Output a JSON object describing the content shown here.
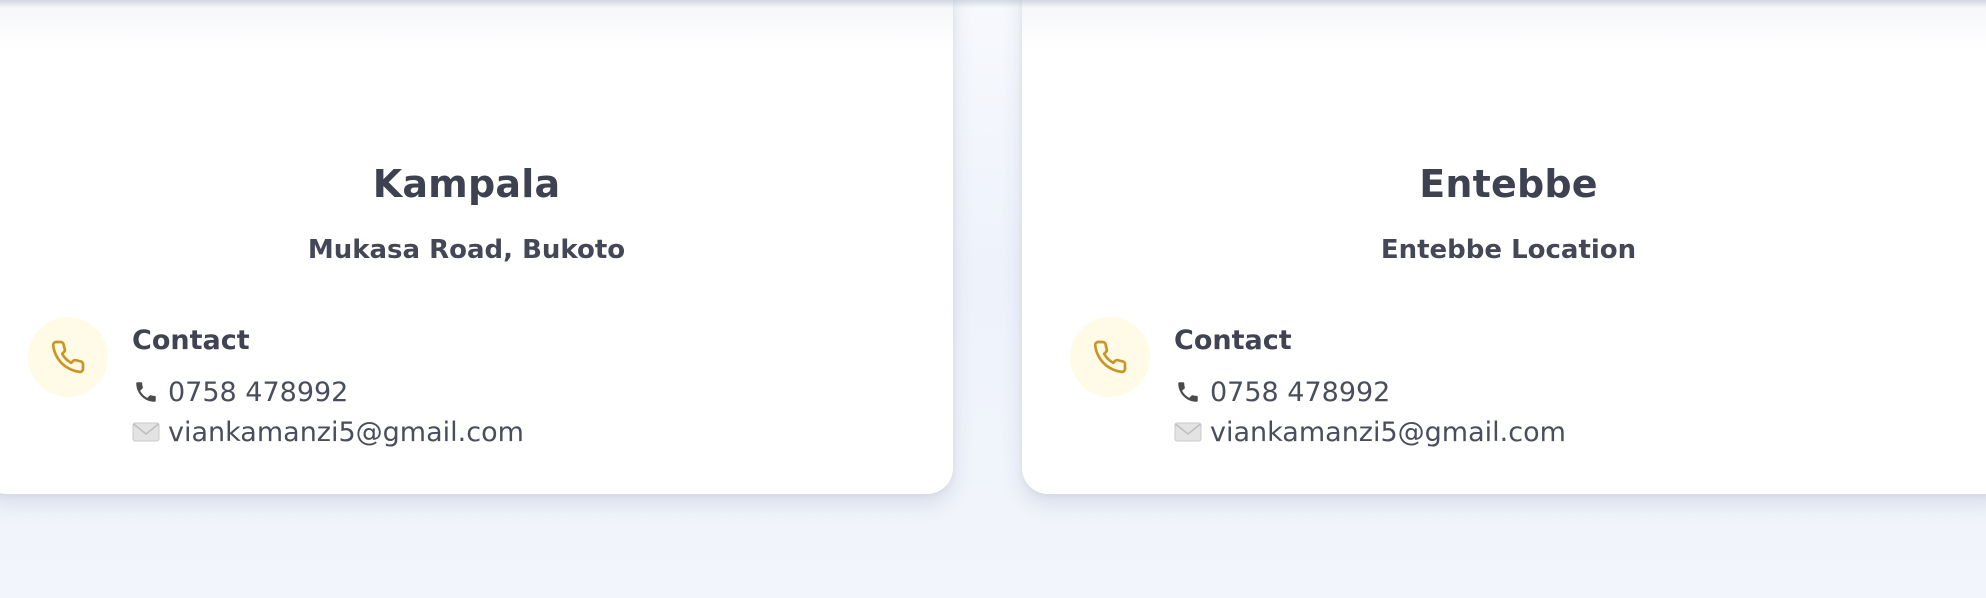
{
  "locations": [
    {
      "city": "Kampala",
      "address": "Mukasa Road, Bukoto",
      "contact_heading": "Contact",
      "phone": "0758 478992",
      "email": "viankamanzi5@gmail.com",
      "icons": {
        "badge": "phone-icon",
        "phone_line": "telephone-receiver-icon",
        "email_line": "envelope-icon"
      }
    },
    {
      "city": "Entebbe",
      "address": "Entebbe Location",
      "contact_heading": "Contact",
      "phone": "0758 478992",
      "email": "viankamanzi5@gmail.com",
      "icons": {
        "badge": "phone-icon",
        "phone_line": "telephone-receiver-icon",
        "email_line": "envelope-icon"
      }
    }
  ],
  "colors": {
    "page_background": "#eef2fb",
    "card_background": "#ffffff",
    "badge_background": "#fffbe6",
    "badge_icon": "#c99527",
    "heading_text": "#3e4250",
    "body_text": "#4a4e5c"
  }
}
